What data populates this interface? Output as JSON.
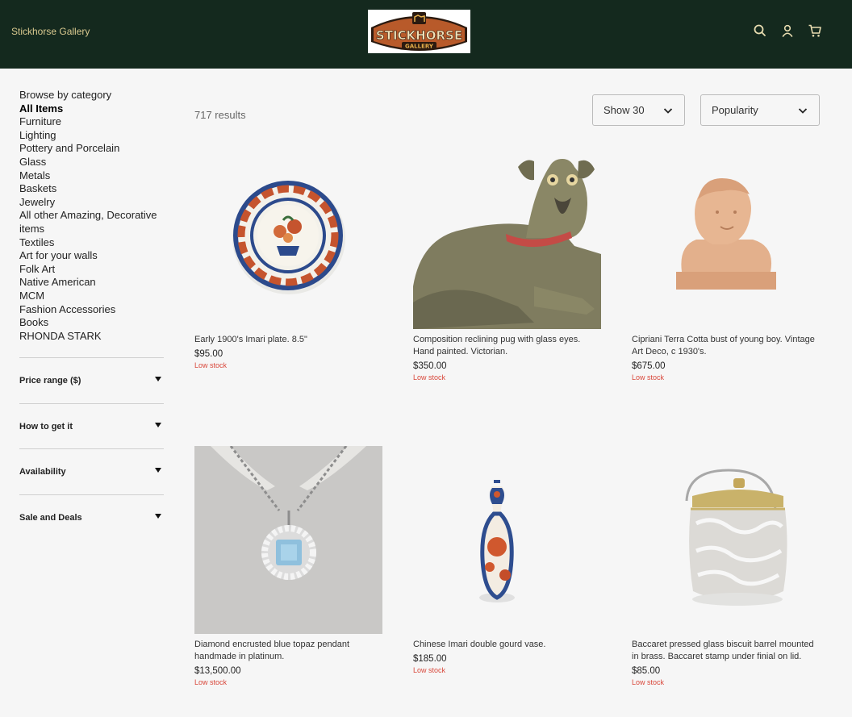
{
  "header": {
    "store_name": "Stickhorse Gallery",
    "logo_text": "STICKHORSE",
    "logo_sub": "GALLERY",
    "icons": [
      "search-icon",
      "account-icon",
      "cart-icon"
    ]
  },
  "sidebar": {
    "browse_title": "Browse by category",
    "categories": [
      "All Items",
      "Furniture",
      "Lighting",
      "Pottery and Porcelain",
      "Glass",
      "Metals",
      "Baskets",
      "Jewelry",
      "All other Amazing, Decorative items",
      "Textiles",
      "Art for your walls",
      "Folk Art",
      "Native American",
      "MCM",
      "Fashion Accessories",
      "Books",
      "RHONDA STARK"
    ],
    "active_category": "All Items",
    "filters": [
      "Price range ($)",
      "How to get it",
      "Availability",
      "Sale and Deals"
    ]
  },
  "results": {
    "count_label": "717 results",
    "show_label": "Show 30",
    "sort_label": "Popularity"
  },
  "products": [
    {
      "title": "Early 1900's Imari plate. 8.5\"",
      "price": "$95.00",
      "stock": "Low stock",
      "icon": "imari-plate"
    },
    {
      "title": "Composition reclining pug with glass eyes. Hand painted. Victorian.",
      "price": "$350.00",
      "stock": "Low stock",
      "icon": "pug-figure"
    },
    {
      "title": "Cipriani Terra Cotta bust of young boy. Vintage Art Deco, c 1930's.",
      "price": "$675.00",
      "stock": "Low stock",
      "icon": "terracotta-bust"
    },
    {
      "title": "Diamond encrusted blue topaz pendant handmade in platinum.",
      "price": "$13,500.00",
      "stock": "Low stock",
      "icon": "topaz-pendant"
    },
    {
      "title": "Chinese Imari double gourd vase.",
      "price": "$185.00",
      "stock": "Low stock",
      "icon": "gourd-vase"
    },
    {
      "title": "Baccaret pressed glass biscuit barrel mounted in brass. Baccaret stamp under finial on lid.",
      "price": "$85.00",
      "stock": "Low stock",
      "icon": "biscuit-barrel"
    }
  ],
  "colors": {
    "header_bg": "#14291e",
    "store_name": "#d9c98f",
    "stock_red": "#d9483b",
    "page_bg": "#f6f6f6"
  }
}
